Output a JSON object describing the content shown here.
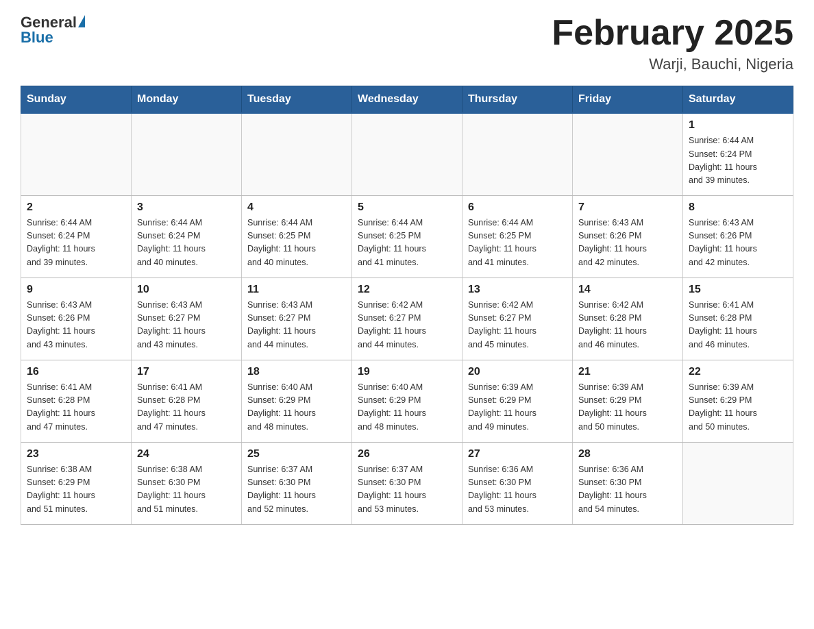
{
  "header": {
    "logo_general": "General",
    "logo_blue": "Blue",
    "title": "February 2025",
    "subtitle": "Warji, Bauchi, Nigeria"
  },
  "weekdays": [
    "Sunday",
    "Monday",
    "Tuesday",
    "Wednesday",
    "Thursday",
    "Friday",
    "Saturday"
  ],
  "weeks": [
    [
      {
        "day": "",
        "info": ""
      },
      {
        "day": "",
        "info": ""
      },
      {
        "day": "",
        "info": ""
      },
      {
        "day": "",
        "info": ""
      },
      {
        "day": "",
        "info": ""
      },
      {
        "day": "",
        "info": ""
      },
      {
        "day": "1",
        "info": "Sunrise: 6:44 AM\nSunset: 6:24 PM\nDaylight: 11 hours\nand 39 minutes."
      }
    ],
    [
      {
        "day": "2",
        "info": "Sunrise: 6:44 AM\nSunset: 6:24 PM\nDaylight: 11 hours\nand 39 minutes."
      },
      {
        "day": "3",
        "info": "Sunrise: 6:44 AM\nSunset: 6:24 PM\nDaylight: 11 hours\nand 40 minutes."
      },
      {
        "day": "4",
        "info": "Sunrise: 6:44 AM\nSunset: 6:25 PM\nDaylight: 11 hours\nand 40 minutes."
      },
      {
        "day": "5",
        "info": "Sunrise: 6:44 AM\nSunset: 6:25 PM\nDaylight: 11 hours\nand 41 minutes."
      },
      {
        "day": "6",
        "info": "Sunrise: 6:44 AM\nSunset: 6:25 PM\nDaylight: 11 hours\nand 41 minutes."
      },
      {
        "day": "7",
        "info": "Sunrise: 6:43 AM\nSunset: 6:26 PM\nDaylight: 11 hours\nand 42 minutes."
      },
      {
        "day": "8",
        "info": "Sunrise: 6:43 AM\nSunset: 6:26 PM\nDaylight: 11 hours\nand 42 minutes."
      }
    ],
    [
      {
        "day": "9",
        "info": "Sunrise: 6:43 AM\nSunset: 6:26 PM\nDaylight: 11 hours\nand 43 minutes."
      },
      {
        "day": "10",
        "info": "Sunrise: 6:43 AM\nSunset: 6:27 PM\nDaylight: 11 hours\nand 43 minutes."
      },
      {
        "day": "11",
        "info": "Sunrise: 6:43 AM\nSunset: 6:27 PM\nDaylight: 11 hours\nand 44 minutes."
      },
      {
        "day": "12",
        "info": "Sunrise: 6:42 AM\nSunset: 6:27 PM\nDaylight: 11 hours\nand 44 minutes."
      },
      {
        "day": "13",
        "info": "Sunrise: 6:42 AM\nSunset: 6:27 PM\nDaylight: 11 hours\nand 45 minutes."
      },
      {
        "day": "14",
        "info": "Sunrise: 6:42 AM\nSunset: 6:28 PM\nDaylight: 11 hours\nand 46 minutes."
      },
      {
        "day": "15",
        "info": "Sunrise: 6:41 AM\nSunset: 6:28 PM\nDaylight: 11 hours\nand 46 minutes."
      }
    ],
    [
      {
        "day": "16",
        "info": "Sunrise: 6:41 AM\nSunset: 6:28 PM\nDaylight: 11 hours\nand 47 minutes."
      },
      {
        "day": "17",
        "info": "Sunrise: 6:41 AM\nSunset: 6:28 PM\nDaylight: 11 hours\nand 47 minutes."
      },
      {
        "day": "18",
        "info": "Sunrise: 6:40 AM\nSunset: 6:29 PM\nDaylight: 11 hours\nand 48 minutes."
      },
      {
        "day": "19",
        "info": "Sunrise: 6:40 AM\nSunset: 6:29 PM\nDaylight: 11 hours\nand 48 minutes."
      },
      {
        "day": "20",
        "info": "Sunrise: 6:39 AM\nSunset: 6:29 PM\nDaylight: 11 hours\nand 49 minutes."
      },
      {
        "day": "21",
        "info": "Sunrise: 6:39 AM\nSunset: 6:29 PM\nDaylight: 11 hours\nand 50 minutes."
      },
      {
        "day": "22",
        "info": "Sunrise: 6:39 AM\nSunset: 6:29 PM\nDaylight: 11 hours\nand 50 minutes."
      }
    ],
    [
      {
        "day": "23",
        "info": "Sunrise: 6:38 AM\nSunset: 6:29 PM\nDaylight: 11 hours\nand 51 minutes."
      },
      {
        "day": "24",
        "info": "Sunrise: 6:38 AM\nSunset: 6:30 PM\nDaylight: 11 hours\nand 51 minutes."
      },
      {
        "day": "25",
        "info": "Sunrise: 6:37 AM\nSunset: 6:30 PM\nDaylight: 11 hours\nand 52 minutes."
      },
      {
        "day": "26",
        "info": "Sunrise: 6:37 AM\nSunset: 6:30 PM\nDaylight: 11 hours\nand 53 minutes."
      },
      {
        "day": "27",
        "info": "Sunrise: 6:36 AM\nSunset: 6:30 PM\nDaylight: 11 hours\nand 53 minutes."
      },
      {
        "day": "28",
        "info": "Sunrise: 6:36 AM\nSunset: 6:30 PM\nDaylight: 11 hours\nand 54 minutes."
      },
      {
        "day": "",
        "info": ""
      }
    ]
  ]
}
